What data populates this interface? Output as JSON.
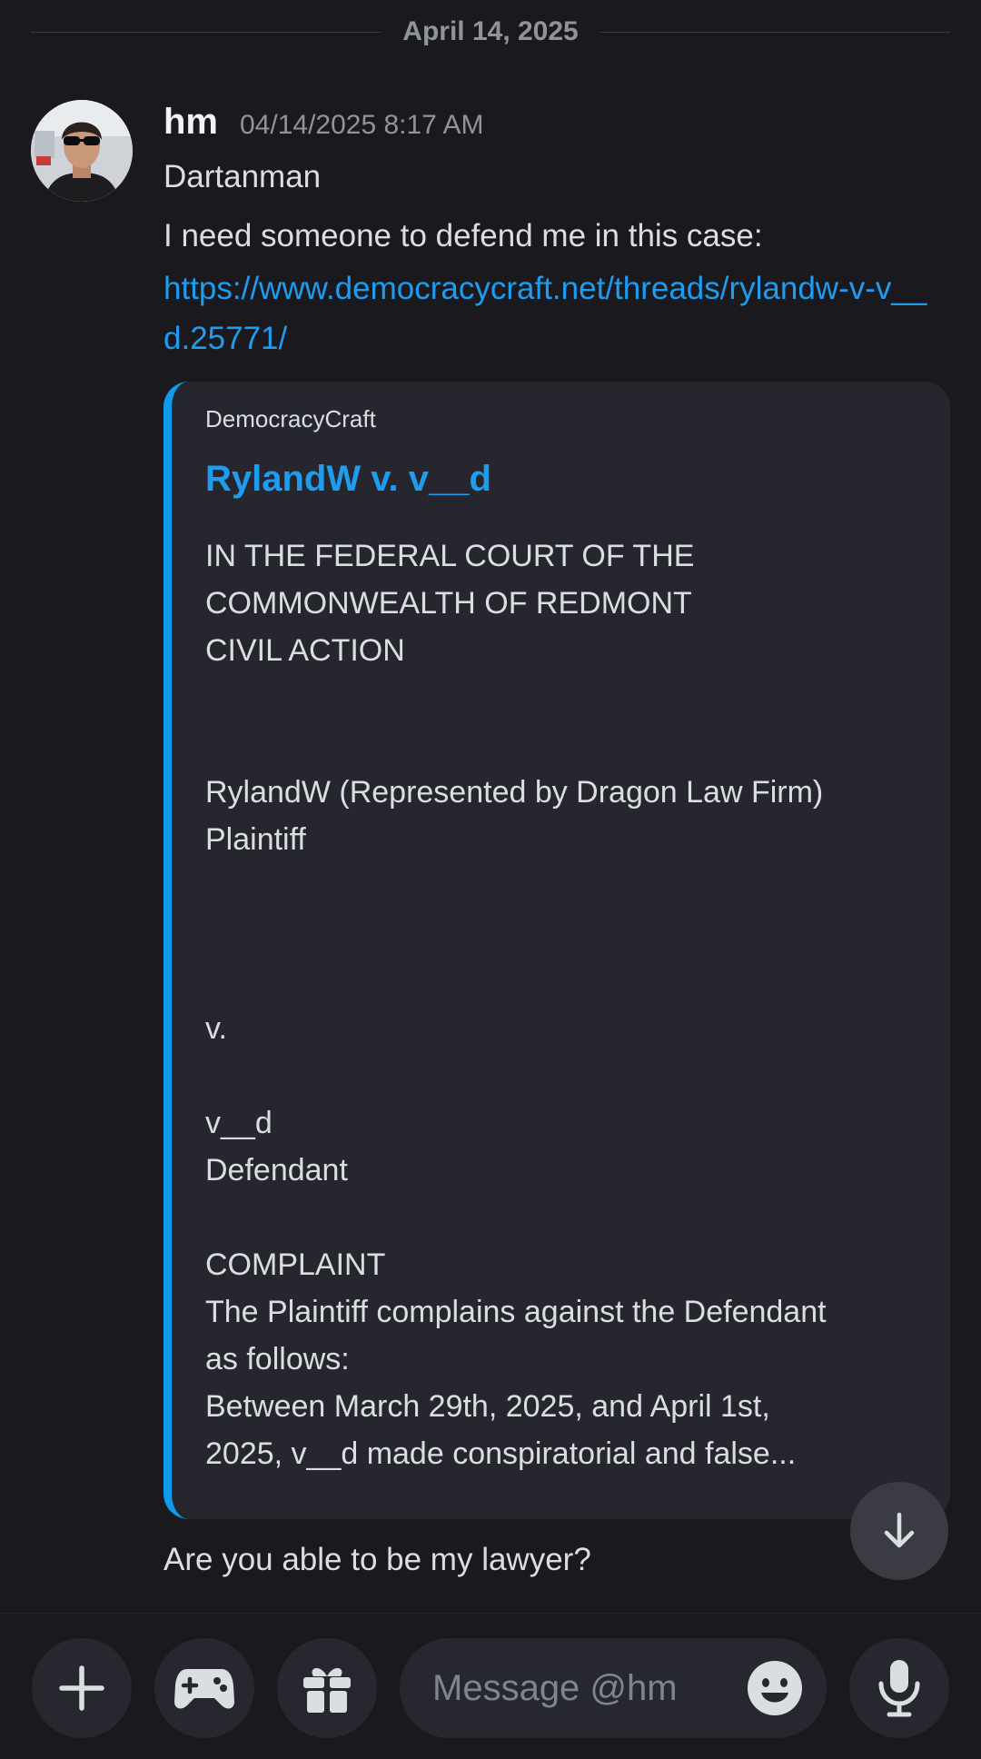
{
  "date_divider": "April 14, 2025",
  "message": {
    "username": "hm",
    "timestamp": "04/14/2025 8:17 AM",
    "lines": [
      "Dartanman",
      "I need someone to defend me in this case:"
    ],
    "link": "https://www.democracycraft.net/threads/rylandw-v-v__d.25771/"
  },
  "embed": {
    "provider": "DemocracyCraft",
    "title": "RylandW v. v__d",
    "description": "IN THE FEDERAL COURT OF THE\nCOMMONWEALTH OF REDMONT\nCIVIL ACTION\n\n\nRylandW (Represented by Dragon Law Firm)\nPlaintiff\n\n\n\nv.\n\nv__d\nDefendant\n\nCOMPLAINT\nThe Plaintiff complains against the Defendant\nas follows:\nBetween March 29th, 2025, and April 1st,\n2025, v__d made conspiratorial and false...",
    "accent_color": "#0f9bea"
  },
  "followup_message": "Are you able to be my lawyer?",
  "composer": {
    "placeholder": "Message @hm"
  },
  "icons": {
    "add": "plus-icon",
    "games": "gamepad-icon",
    "gift": "gift-icon",
    "emoji": "emoji-icon",
    "voice": "microphone-icon",
    "scroll": "arrow-down-icon"
  },
  "colors": {
    "background": "#1a1a1e",
    "link": "#1e9cf0",
    "embed_background": "#26272e"
  }
}
